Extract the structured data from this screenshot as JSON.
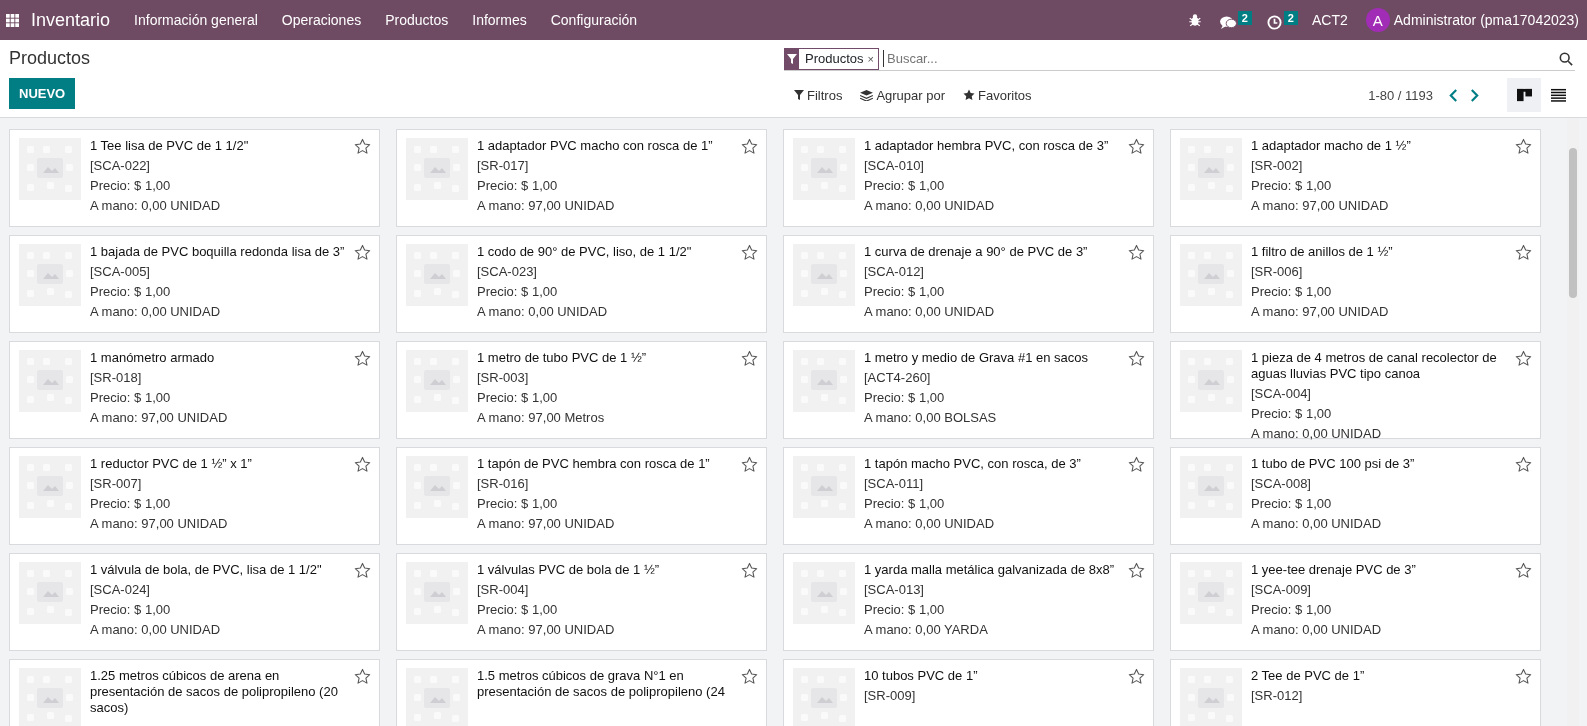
{
  "navbar": {
    "app_name": "Inventario",
    "menu": [
      "Información general",
      "Operaciones",
      "Productos",
      "Informes",
      "Configuración"
    ],
    "messages_count": "2",
    "activities_count": "2",
    "company": "ACT2",
    "avatar_letter": "A",
    "user": "Administrator (pma17042023)"
  },
  "control_panel": {
    "title": "Productos",
    "new_button": "NUEVO",
    "facet": "Productos",
    "facet_remove": "×",
    "search_placeholder": "Buscar...",
    "filters": "Filtros",
    "group_by": "Agrupar por",
    "favorites": "Favoritos",
    "pager": "1-80 / 1193",
    "views": [
      {
        "kind": "kanban",
        "selected": true
      },
      {
        "kind": "list",
        "selected": false
      }
    ]
  },
  "products": [
    {
      "name": "1 Tee lisa de PVC de 1 1/2\"",
      "code": "[SCA-022]",
      "price": "Precio: $ 1,00",
      "on_hand": "A mano: 0,00 UNIDAD"
    },
    {
      "name": "1 adaptador PVC macho con rosca de 1”",
      "code": "[SR-017]",
      "price": "Precio: $ 1,00",
      "on_hand": "A mano: 97,00 UNIDAD"
    },
    {
      "name": "1 adaptador hembra PVC, con rosca de 3”",
      "code": "[SCA-010]",
      "price": "Precio: $ 1,00",
      "on_hand": "A mano: 0,00 UNIDAD"
    },
    {
      "name": "1 adaptador macho de 1 ½”",
      "code": "[SR-002]",
      "price": "Precio: $ 1,00",
      "on_hand": "A mano: 97,00 UNIDAD"
    },
    {
      "name": "1 bajada de PVC boquilla redonda lisa de 3”",
      "code": "[SCA-005]",
      "price": "Precio: $ 1,00",
      "on_hand": "A mano: 0,00 UNIDAD"
    },
    {
      "name": "1 codo de 90° de PVC, liso, de 1 1/2\"",
      "code": "[SCA-023]",
      "price": "Precio: $ 1,00",
      "on_hand": "A mano: 0,00 UNIDAD"
    },
    {
      "name": "1 curva de drenaje a 90° de PVC de 3”",
      "code": "[SCA-012]",
      "price": "Precio: $ 1,00",
      "on_hand": "A mano: 0,00 UNIDAD"
    },
    {
      "name": "1 filtro de anillos de 1 ½”",
      "code": "[SR-006]",
      "price": "Precio: $ 1,00",
      "on_hand": "A mano: 97,00 UNIDAD"
    },
    {
      "name": "1 manómetro armado",
      "code": "[SR-018]",
      "price": "Precio: $ 1,00",
      "on_hand": "A mano: 97,00 UNIDAD"
    },
    {
      "name": "1 metro de tubo PVC de 1 ½”",
      "code": "[SR-003]",
      "price": "Precio: $ 1,00",
      "on_hand": "A mano: 97,00 Metros"
    },
    {
      "name": "1 metro y medio de Grava #1 en sacos",
      "code": "[ACT4-260]",
      "price": "Precio: $ 1,00",
      "on_hand": "A mano: 0,00 BOLSAS"
    },
    {
      "name": "1 pieza de 4 metros de canal recolector de aguas lluvias PVC tipo canoa",
      "code": "[SCA-004]",
      "price": "Precio: $ 1,00",
      "on_hand": "A mano: 0,00 UNIDAD"
    },
    {
      "name": "1 reductor PVC de 1 ½” x 1”",
      "code": "[SR-007]",
      "price": "Precio: $ 1,00",
      "on_hand": "A mano: 97,00 UNIDAD"
    },
    {
      "name": "1 tapón de PVC hembra con rosca de 1”",
      "code": "[SR-016]",
      "price": "Precio: $ 1,00",
      "on_hand": "A mano: 97,00 UNIDAD"
    },
    {
      "name": "1 tapón macho PVC, con rosca, de 3”",
      "code": "[SCA-011]",
      "price": "Precio: $ 1,00",
      "on_hand": "A mano: 0,00 UNIDAD"
    },
    {
      "name": "1 tubo de PVC 100 psi de 3”",
      "code": "[SCA-008]",
      "price": "Precio: $ 1,00",
      "on_hand": "A mano: 0,00 UNIDAD"
    },
    {
      "name": "1 válvula de bola, de PVC, lisa de 1 1/2\"",
      "code": "[SCA-024]",
      "price": "Precio: $ 1,00",
      "on_hand": "A mano: 0,00 UNIDAD"
    },
    {
      "name": "1 válvulas PVC de bola de 1 ½”",
      "code": "[SR-004]",
      "price": "Precio: $ 1,00",
      "on_hand": "A mano: 97,00 UNIDAD"
    },
    {
      "name": "1 yarda malla metálica galvanizada de 8x8”",
      "code": "[SCA-013]",
      "price": "Precio: $ 1,00",
      "on_hand": "A mano: 0,00 YARDA"
    },
    {
      "name": "1 yee-tee drenaje PVC de 3”",
      "code": "[SCA-009]",
      "price": "Precio: $ 1,00",
      "on_hand": "A mano: 0,00 UNIDAD"
    },
    {
      "name": "1.25 metros cúbicos de arena en presentación de sacos de polipropileno (20 sacos)"
    },
    {
      "name": "1.5 metros cúbicos de grava N°1 en presentación de sacos de polipropileno (24"
    },
    {
      "name": "10 tubos PVC de 1”",
      "code": "[SR-009]"
    },
    {
      "name": "2 Tee de PVC de 1”",
      "code": "[SR-012]"
    }
  ]
}
